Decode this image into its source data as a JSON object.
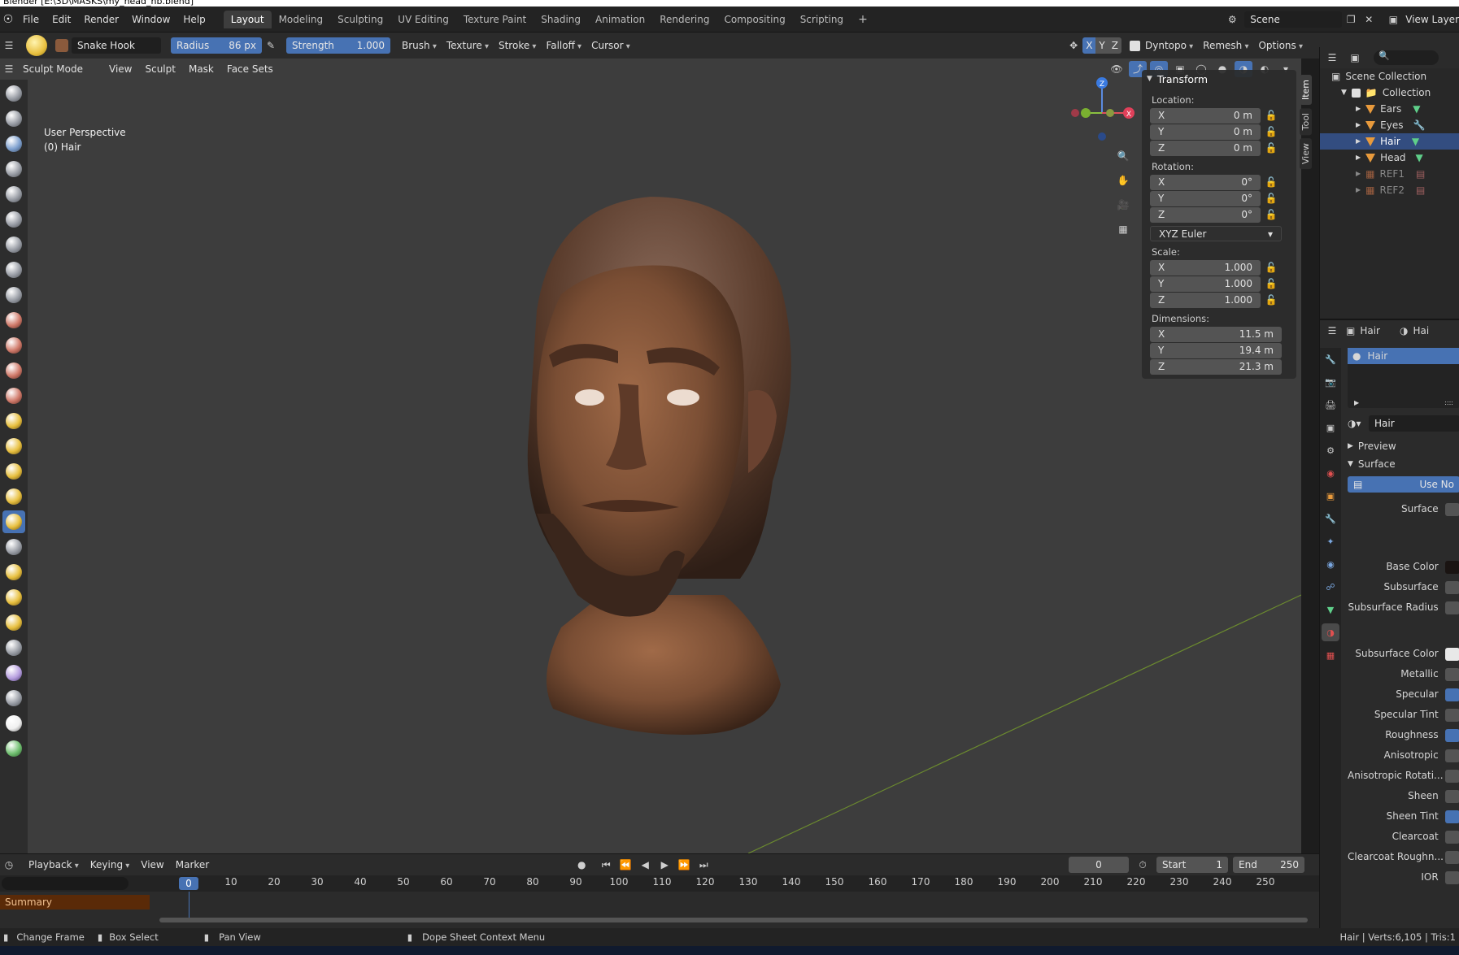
{
  "window": {
    "title": "Blender [E:\\3D\\MASKS\\my_head_hb.blend]"
  },
  "menu": [
    "File",
    "Edit",
    "Render",
    "Window",
    "Help"
  ],
  "workspaces": [
    {
      "label": "Layout",
      "active": true
    },
    {
      "label": "Modeling"
    },
    {
      "label": "Sculpting"
    },
    {
      "label": "UV Editing"
    },
    {
      "label": "Texture Paint"
    },
    {
      "label": "Shading"
    },
    {
      "label": "Animation"
    },
    {
      "label": "Rendering"
    },
    {
      "label": "Compositing"
    },
    {
      "label": "Scripting"
    }
  ],
  "scene": {
    "name": "Scene",
    "view_layer": "View Layer"
  },
  "tool": {
    "brush_name": "Snake Hook",
    "radius_label": "Radius",
    "radius_value": "86 px",
    "strength_label": "Strength",
    "strength_value": "1.000",
    "dropdowns": [
      "Brush",
      "Texture",
      "Stroke",
      "Falloff",
      "Cursor"
    ],
    "axes": [
      "X",
      "Y",
      "Z"
    ],
    "dyntopo": "Dyntopo",
    "remesh": "Remesh",
    "options": "Options"
  },
  "viewport": {
    "mode": "Sculpt Mode",
    "menus": [
      "View",
      "Sculpt",
      "Mask",
      "Face Sets"
    ],
    "overlay_title": "User Perspective",
    "overlay_object": "(0) Hair",
    "gizmo": {
      "x": "X",
      "y": "Y",
      "z": "Z"
    }
  },
  "transform": {
    "title": "Transform",
    "location_label": "Location:",
    "location": [
      {
        "axis": "X",
        "value": "0 m"
      },
      {
        "axis": "Y",
        "value": "0 m"
      },
      {
        "axis": "Z",
        "value": "0 m"
      }
    ],
    "rotation_label": "Rotation:",
    "rotation": [
      {
        "axis": "X",
        "value": "0°"
      },
      {
        "axis": "Y",
        "value": "0°"
      },
      {
        "axis": "Z",
        "value": "0°"
      }
    ],
    "rotation_mode": "XYZ Euler",
    "scale_label": "Scale:",
    "scale": [
      {
        "axis": "X",
        "value": "1.000"
      },
      {
        "axis": "Y",
        "value": "1.000"
      },
      {
        "axis": "Z",
        "value": "1.000"
      }
    ],
    "dimensions_label": "Dimensions:",
    "dimensions": [
      {
        "axis": "X",
        "value": "11.5 m"
      },
      {
        "axis": "Y",
        "value": "19.4 m"
      },
      {
        "axis": "Z",
        "value": "21.3 m"
      }
    ]
  },
  "sidebar_tabs": [
    "Item",
    "Tool",
    "View"
  ],
  "outliner": {
    "root": "Scene Collection",
    "collection": "Collection",
    "items": [
      {
        "name": "Ears"
      },
      {
        "name": "Eyes"
      },
      {
        "name": "Hair",
        "selected": true
      },
      {
        "name": "Head"
      },
      {
        "name": "REF1"
      },
      {
        "name": "REF2"
      }
    ]
  },
  "properties": {
    "object_name": "Hair",
    "material_tab": "Hai",
    "material_slot": "Hair",
    "material_name": "Hair",
    "preview": "Preview",
    "surface": "Surface",
    "use_nodes": "Use No",
    "surface_label": "Surface",
    "params": [
      "Base Color",
      "Subsurface",
      "Subsurface Radius",
      "Subsurface Color",
      "Metallic",
      "Specular",
      "Specular Tint",
      "Roughness",
      "Anisotropic",
      "Anisotropic Rotati...",
      "Sheen",
      "Sheen Tint",
      "Clearcoat",
      "Clearcoat Roughn...",
      "IOR"
    ]
  },
  "timeline": {
    "menus": [
      "Playback",
      "Keying",
      "View",
      "Marker"
    ],
    "current_frame": "0",
    "start_label": "Start",
    "start": "1",
    "end_label": "End",
    "end": "250",
    "ticks": [
      "10",
      "20",
      "30",
      "40",
      "50",
      "60",
      "70",
      "80",
      "90",
      "100",
      "110",
      "120",
      "130",
      "140",
      "150",
      "160",
      "170",
      "180",
      "190",
      "200",
      "210",
      "220",
      "230",
      "240",
      "250"
    ],
    "playhead": "0",
    "summary": "Summary"
  },
  "status": {
    "change_frame": "Change Frame",
    "box_select": "Box Select",
    "pan_view": "Pan View",
    "context_menu": "Dope Sheet Context Menu",
    "stats": "Hair | Verts:6,105 | Tris:1"
  },
  "colors": {
    "accent": "#4772b3",
    "header": "#2b2b2b",
    "viewport": "#3d3d3d",
    "orange": "#e89a3c",
    "skin": "#8a5a3c"
  }
}
